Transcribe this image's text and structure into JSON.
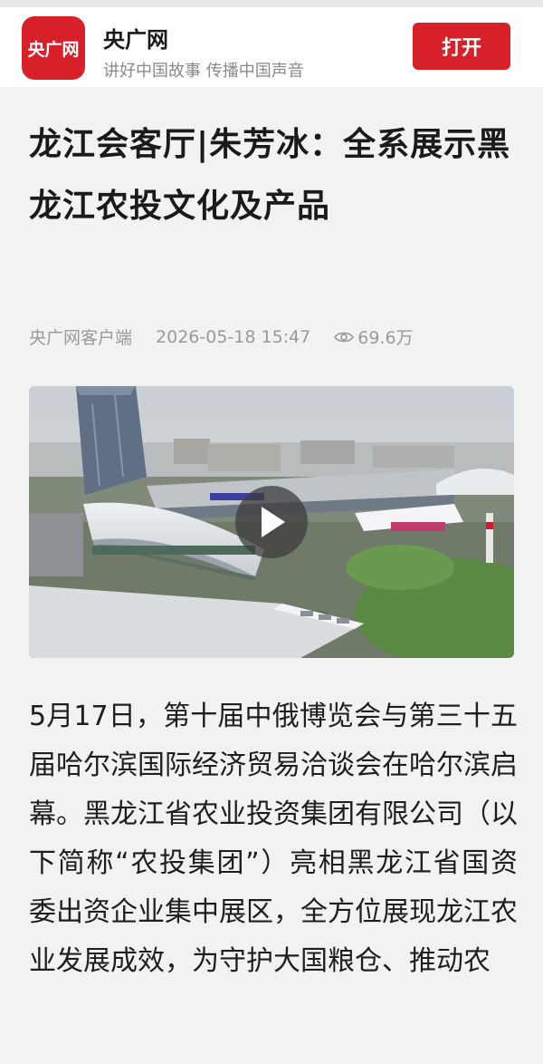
{
  "app": {
    "logo_text": "央广网",
    "name": "央广网",
    "slogan": "讲好中国故事 传播中国声音",
    "open_label": "打开"
  },
  "article": {
    "title": "龙江会客厅|朱芳冰：全系展示黑龙江农投文化及产品",
    "source": "央广网客户端",
    "datetime": "2026-05-18 15:47",
    "views": "69.6万",
    "body": "5月17日，第十届中俄博览会与第三十五届哈尔滨国际经济贸易洽谈会在哈尔滨启幕。黑龙江省农业投资集团有限公司（以下简称“农投集团”）亮相黑龙江省国资委出资企业集中展区，全方位展现龙江农业发展成效，为守护大国粮仓、推动农"
  },
  "colors": {
    "brand": "#d7202a",
    "meta_text": "#9a9a9a",
    "background": "#f2f2f2"
  },
  "icons": {
    "views": "eye-icon",
    "play": "play-icon"
  }
}
